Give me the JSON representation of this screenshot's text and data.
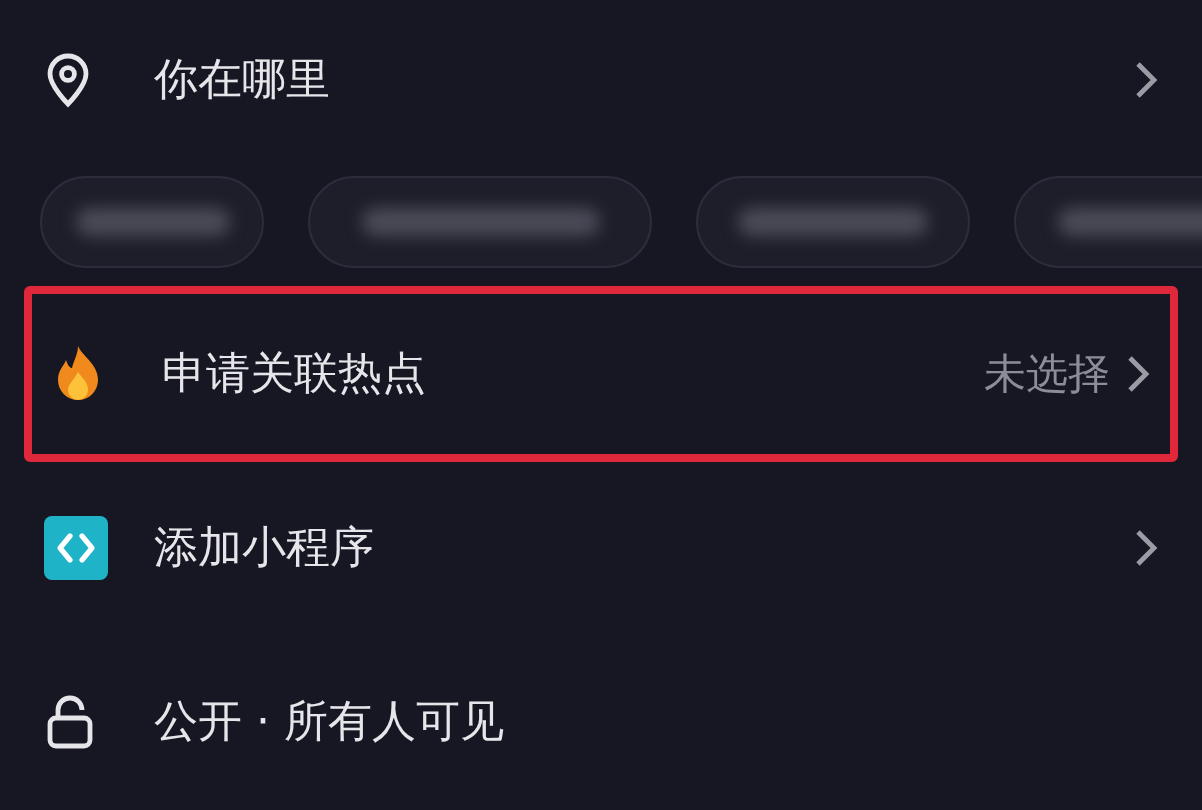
{
  "rows": [
    {
      "kind": "location",
      "label": "你在哪里",
      "highlighted": false,
      "chevron": true
    },
    {
      "kind": "chips",
      "chips": [
        {
          "kind": "blurred"
        },
        {
          "kind": "blurred"
        },
        {
          "kind": "blurred"
        },
        {
          "kind": "blurred"
        }
      ]
    },
    {
      "kind": "hotspot",
      "label": "申请关联热点",
      "value": "未选择",
      "highlighted": true,
      "chevron": true
    },
    {
      "kind": "mini-program",
      "label": "添加小程序",
      "highlighted": false,
      "chevron": true
    },
    {
      "kind": "visibility",
      "label": "公开 · 所有人可见",
      "highlighted": false,
      "chevron": false
    }
  ]
}
